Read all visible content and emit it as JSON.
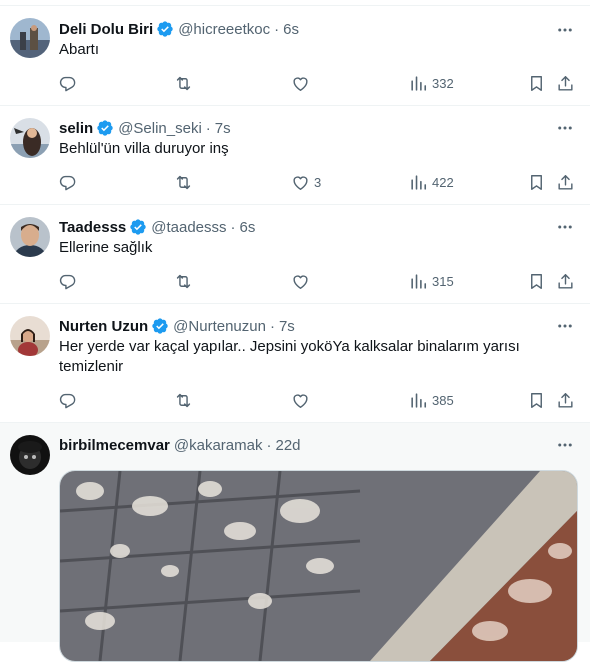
{
  "tweets": [
    {
      "name": "Deli Dolu Biri",
      "handle": "@hicreeetkoc",
      "time": "6s",
      "text": "Abartı",
      "likes": "",
      "views": "332"
    },
    {
      "name": "selin",
      "handle": "@Selin_seki",
      "time": "7s",
      "text": "Behlül'ün villa duruyor inş",
      "likes": "3",
      "views": "422"
    },
    {
      "name": "Taadesss",
      "handle": "@taadesss",
      "time": "6s",
      "text": "Ellerine sağlık",
      "likes": "",
      "views": "315"
    },
    {
      "name": "Nurten Uzun",
      "handle": "@Nurtenuzun",
      "time": "7s",
      "text": "Her yerde var kaçal yapılar.. Jepsini yoköYa kalksalar binalarım yarısı temizlenir",
      "likes": "",
      "views": "385"
    },
    {
      "name": "birbilmecemvar",
      "handle": "@kakaramak",
      "time": "22d",
      "text": "",
      "likes": "",
      "views": ""
    }
  ],
  "icons": {
    "verified": "verified-badge-icon",
    "more": "more-icon",
    "reply": "reply-icon",
    "retweet": "retweet-icon",
    "like": "like-icon",
    "views": "views-icon",
    "bookmark": "bookmark-icon",
    "share": "share-icon"
  },
  "colors": {
    "verified": "#1d9bf0",
    "secondary_text": "#536471",
    "primary_text": "#0f1419"
  }
}
